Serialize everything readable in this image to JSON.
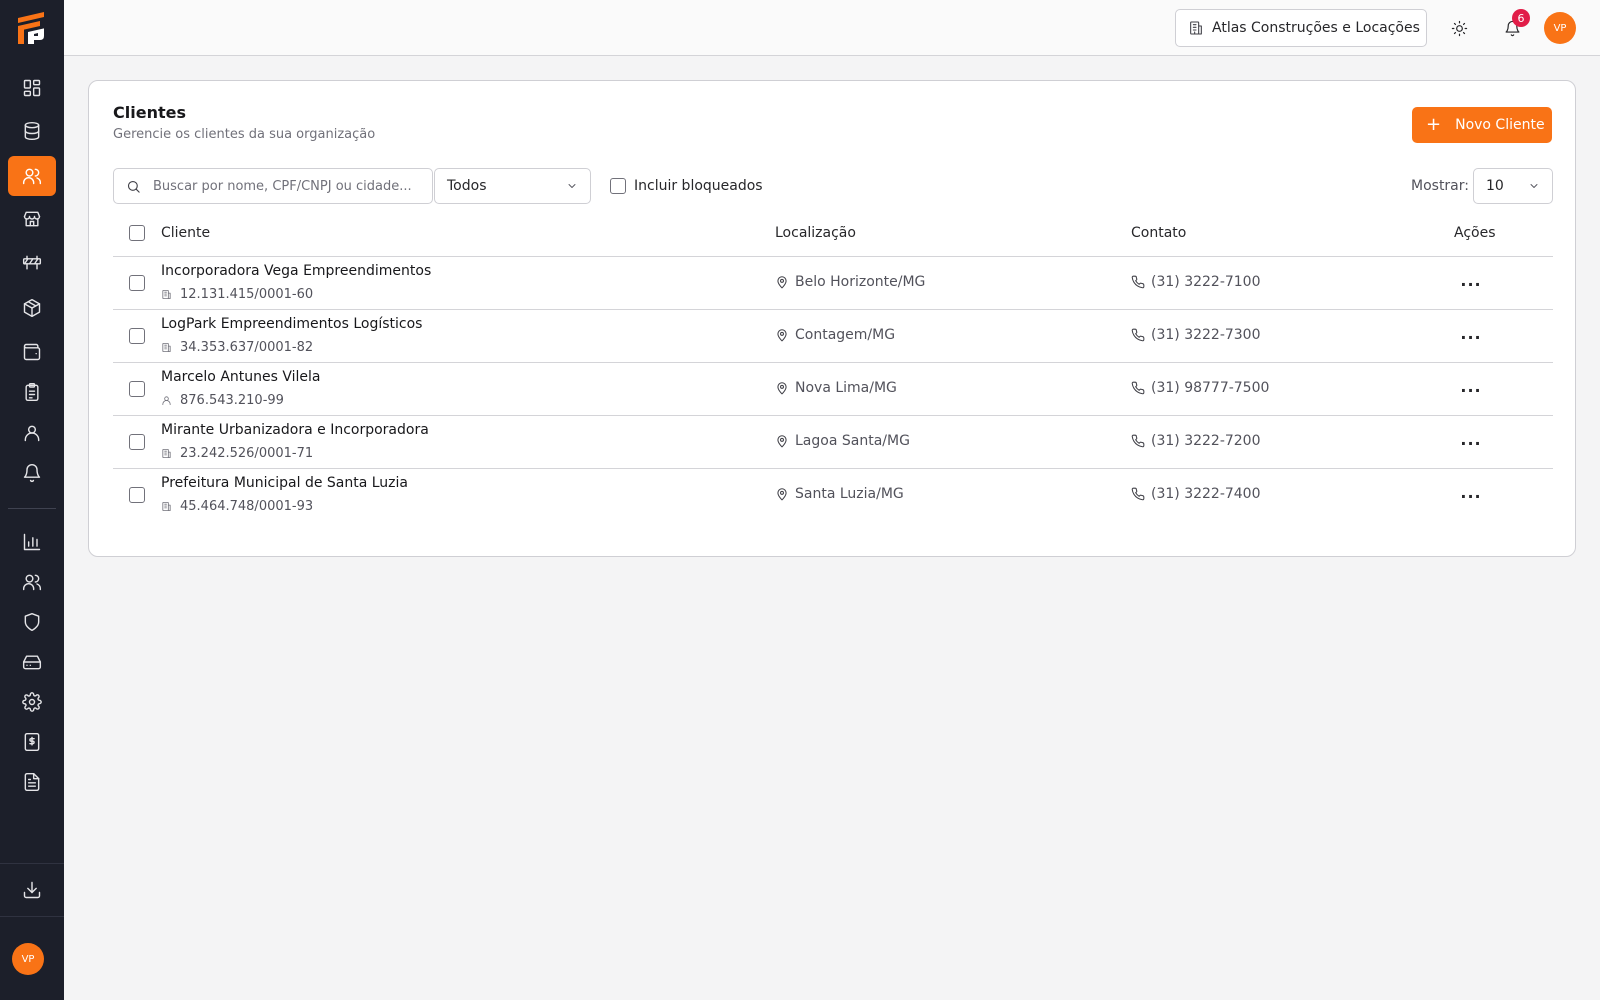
{
  "sidebar": {
    "items": [
      {
        "name": "dashboard",
        "icon": "layout-grid-icon"
      },
      {
        "name": "database",
        "icon": "database-icon"
      },
      {
        "name": "clients",
        "icon": "users-icon",
        "active": true
      },
      {
        "name": "store",
        "icon": "store-icon"
      },
      {
        "name": "traffic-barrier",
        "icon": "construction-barrier-icon"
      },
      {
        "name": "package",
        "icon": "package-icon"
      },
      {
        "name": "wallet",
        "icon": "wallet-icon"
      },
      {
        "name": "clipboard",
        "icon": "clipboard-list-icon"
      },
      {
        "name": "user",
        "icon": "user-icon"
      },
      {
        "name": "notifications",
        "icon": "bell-icon"
      },
      {
        "name": "reports",
        "icon": "bar-chart-icon"
      },
      {
        "name": "users",
        "icon": "users-icon"
      },
      {
        "name": "security",
        "icon": "shield-icon"
      },
      {
        "name": "storage",
        "icon": "hard-drive-icon"
      },
      {
        "name": "settings",
        "icon": "gear-icon"
      },
      {
        "name": "billing",
        "icon": "receipt-dollar-icon"
      },
      {
        "name": "documents",
        "icon": "file-text-icon"
      }
    ],
    "download_icon": "download-icon",
    "avatar_initials": "VP"
  },
  "topbar": {
    "org_name": "Atlas Construções e Locações",
    "notification_count": "6",
    "avatar_initials": "VP"
  },
  "page": {
    "title": "Clientes",
    "subtitle": "Gerencie os clientes da sua organização",
    "new_button": "Novo Cliente",
    "search_placeholder": "Buscar por nome, CPF/CNPJ ou cidade...",
    "filter_value": "Todos",
    "include_blocked_label": "Incluir bloqueados",
    "show_label": "Mostrar:",
    "page_size": "10"
  },
  "table": {
    "columns": {
      "client": "Cliente",
      "location": "Localização",
      "contact": "Contato",
      "actions": "Ações"
    },
    "rows": [
      {
        "name": "Incorporadora Vega Empreendimentos",
        "doc": "12.131.415/0001-60",
        "type": "company",
        "location": "Belo Horizonte/MG",
        "phone": "(31) 3222-7100"
      },
      {
        "name": "LogPark Empreendimentos Logísticos",
        "doc": "34.353.637/0001-82",
        "type": "company",
        "location": "Contagem/MG",
        "phone": "(31) 3222-7300"
      },
      {
        "name": "Marcelo Antunes Vilela",
        "doc": "876.543.210-99",
        "type": "person",
        "location": "Nova Lima/MG",
        "phone": "(31) 98777-7500"
      },
      {
        "name": "Mirante Urbanizadora e Incorporadora",
        "doc": "23.242.526/0001-71",
        "type": "company",
        "location": "Lagoa Santa/MG",
        "phone": "(31) 3222-7200"
      },
      {
        "name": "Prefeitura Municipal de Santa Luzia",
        "doc": "45.464.748/0001-93",
        "type": "company",
        "location": "Santa Luzia/MG",
        "phone": "(31) 3222-7400"
      }
    ]
  },
  "colors": {
    "accent": "#f97316",
    "sidebar": "#1c1f2a",
    "badge": "#e11d48"
  }
}
